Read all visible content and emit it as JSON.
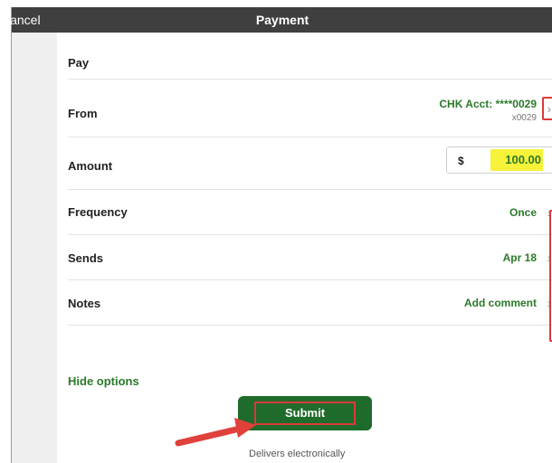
{
  "header": {
    "cancel_label": "Cancel",
    "title": "Payment"
  },
  "form": {
    "pay_label": "Pay",
    "from_label": "From",
    "from_account": "CHK Acct: ****0029",
    "from_account_short": "x0029",
    "amount_label": "Amount",
    "currency_symbol": "$",
    "amount_value": "100.00",
    "frequency_label": "Frequency",
    "frequency_value": "Once",
    "sends_label": "Sends",
    "sends_value": "Apr 18",
    "notes_label": "Notes",
    "notes_value": "Add comment",
    "hide_options_label": "Hide options"
  },
  "actions": {
    "submit_label": "Submit",
    "delivery_note": "Delivers electronically"
  },
  "colors": {
    "accent_green": "#2b7a2b",
    "submit_green": "#1f6b2b",
    "highlight_yellow": "#f7f23a",
    "annotation_red": "#d93a3a",
    "header_bg": "#3f3f3f"
  }
}
